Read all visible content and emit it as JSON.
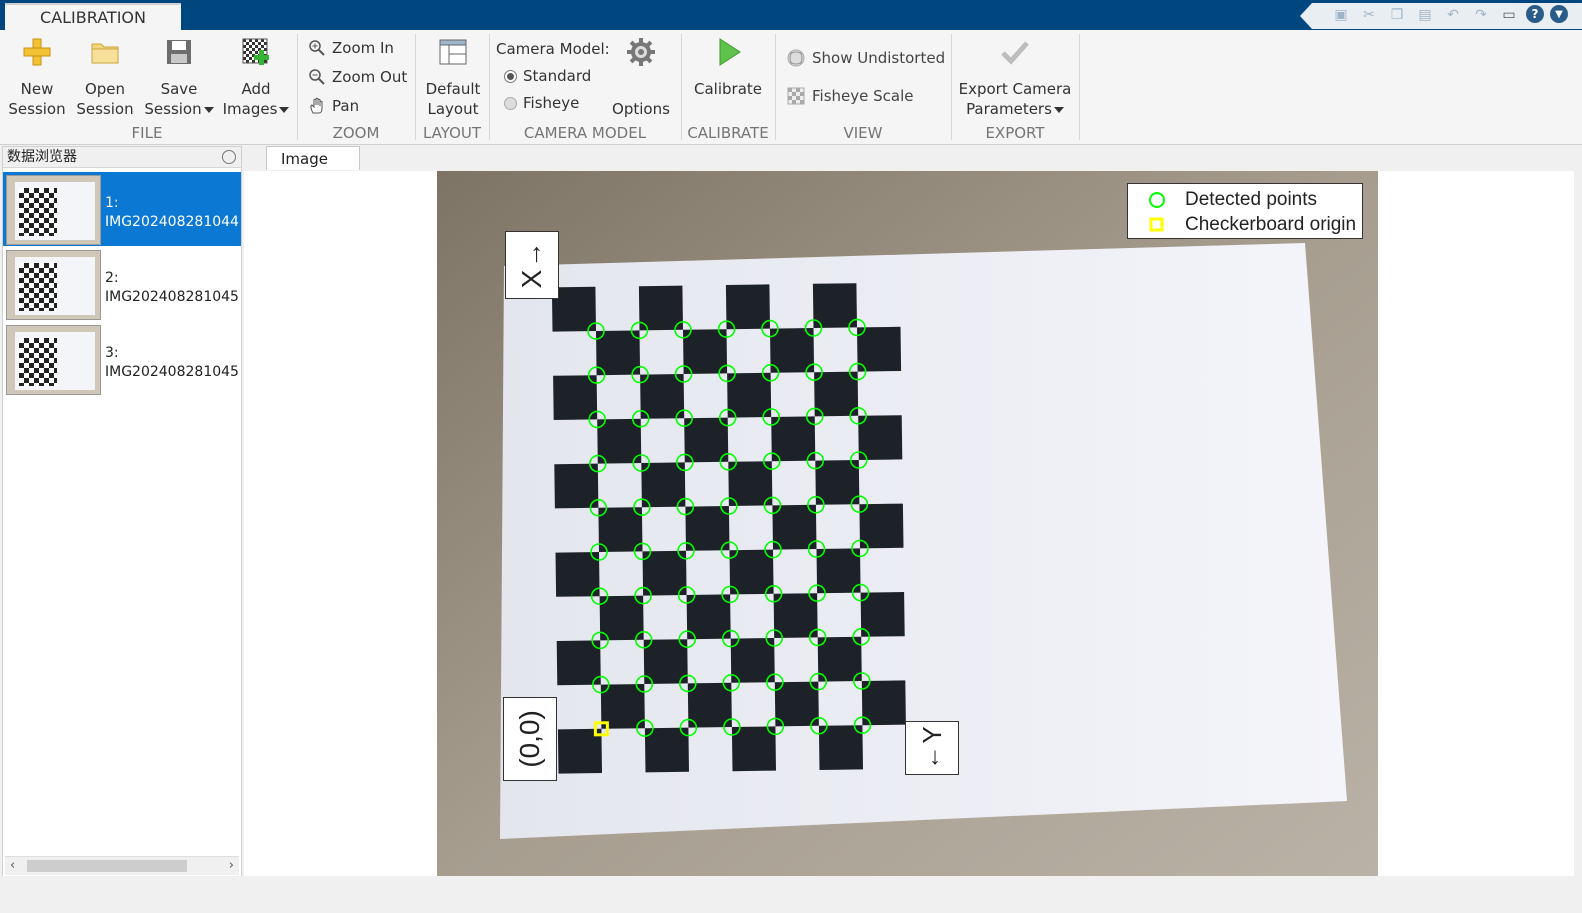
{
  "titlebar": {
    "tab": "CALIBRATION"
  },
  "ribbon": {
    "file": {
      "title": "FILE",
      "new_session": [
        "New",
        "Session"
      ],
      "open_session": [
        "Open",
        "Session"
      ],
      "save_session": [
        "Save",
        "Session"
      ],
      "add_images": [
        "Add",
        "Images"
      ]
    },
    "zoom": {
      "title": "ZOOM",
      "zoom_in": "Zoom In",
      "zoom_out": "Zoom Out",
      "pan": "Pan"
    },
    "layout": {
      "title": "LAYOUT",
      "default_layout": [
        "Default",
        "Layout"
      ]
    },
    "camera_model": {
      "title": "CAMERA MODEL",
      "label": "Camera Model:",
      "standard": "Standard",
      "fisheye": "Fisheye",
      "options": "Options",
      "selected": "Standard"
    },
    "calibrate": {
      "title": "CALIBRATE",
      "calibrate": "Calibrate"
    },
    "view": {
      "title": "VIEW",
      "show_undistorted": "Show Undistorted",
      "fisheye_scale": "Fisheye Scale"
    },
    "export": {
      "title": "EXPORT",
      "export_params": [
        "Export Camera",
        "Parameters"
      ]
    }
  },
  "browser": {
    "title": "数据浏览器",
    "items": [
      {
        "index": "1:",
        "name": "IMG202408281044",
        "selected": true
      },
      {
        "index": "2:",
        "name": "IMG202408281045",
        "selected": false
      },
      {
        "index": "3:",
        "name": "IMG202408281045",
        "selected": false
      }
    ]
  },
  "document_tab": {
    "label": "Image"
  },
  "image": {
    "legend": {
      "detected": "Detected points",
      "origin": "Checkerboard origin"
    },
    "axis_x": "X",
    "axis_y": "Y",
    "origin_label": "(0,0)",
    "detected_color": "#00ff00",
    "origin_color": "#ffff00",
    "grid_rows": 10,
    "grid_cols": 7
  }
}
